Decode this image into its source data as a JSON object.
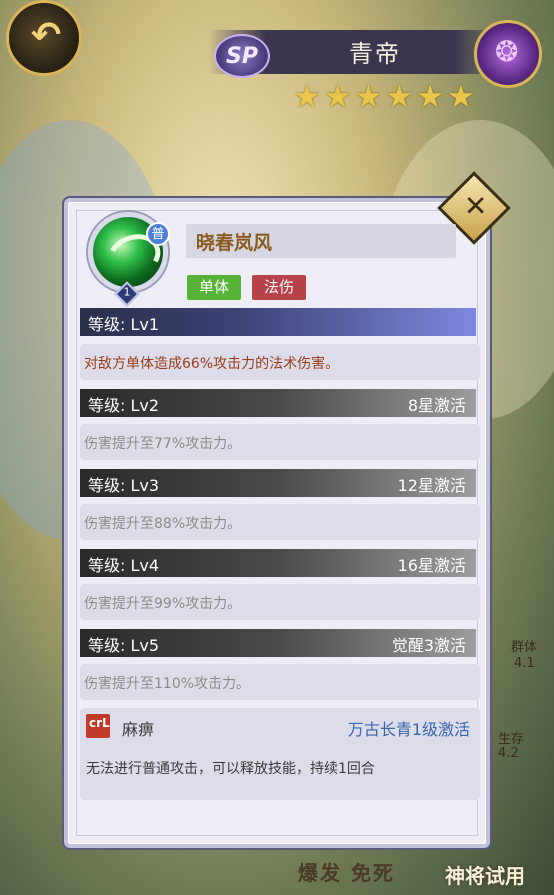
{
  "header": {
    "back_icon": "back-glyph",
    "sp_label": "SP",
    "hero_name": "青帝",
    "element_icon": "flame-icon",
    "star_count": 6,
    "star_glyph": "★"
  },
  "skill": {
    "name": "晓春岚风",
    "grade": "普",
    "level_badge": "1",
    "tags": [
      "单体",
      "法伤"
    ],
    "levels": [
      {
        "label": "等级: Lv1",
        "condition": "",
        "desc": "对敌方单体造成66%攻击力的法术伤害。",
        "active": true
      },
      {
        "label": "等级: Lv2",
        "condition": "8星激活",
        "desc": "伤害提升至77%攻击力。",
        "active": false
      },
      {
        "label": "等级: Lv3",
        "condition": "12星激活",
        "desc": "伤害提升至88%攻击力。",
        "active": false
      },
      {
        "label": "等级: Lv4",
        "condition": "16星激活",
        "desc": "伤害提升至99%攻击力。",
        "active": false
      },
      {
        "label": "等级: Lv5",
        "condition": "觉醒3激活",
        "desc": "伤害提升至110%攻击力。",
        "active": false
      }
    ]
  },
  "effect": {
    "icon_text": "ᴄrL",
    "name": "麻痹",
    "condition": "万古长青1级激活",
    "desc": "无法进行普通攻击，可以释放技能，持续1回合"
  },
  "side_labels": {
    "group": "群体",
    "group_value": "4.1",
    "survive": "生存",
    "survive_value": "4.2"
  },
  "bottom": {
    "left_text": "爆发 免死",
    "right_button": "神将试用"
  },
  "colors": {
    "active_desc": "#9a3c1c",
    "tag_single": "#57b338",
    "tag_magic": "#b8424a",
    "effect_condition": "#3d63b0"
  }
}
